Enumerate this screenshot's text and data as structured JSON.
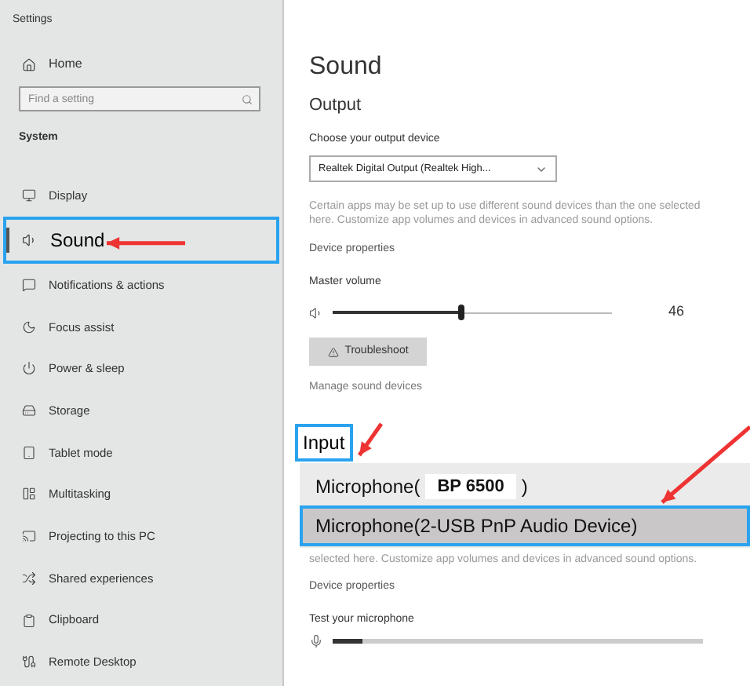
{
  "window": {
    "title": "Settings"
  },
  "sidebar": {
    "home": "Home",
    "search": {
      "placeholder": "Find a setting"
    },
    "section": "System",
    "items": [
      {
        "label": "Display",
        "selected": false
      },
      {
        "label": "Sound",
        "selected": true
      },
      {
        "label": "Notifications & actions",
        "selected": false
      },
      {
        "label": "Focus assist",
        "selected": false
      },
      {
        "label": "Power & sleep",
        "selected": false
      },
      {
        "label": "Storage",
        "selected": false
      },
      {
        "label": "Tablet mode",
        "selected": false
      },
      {
        "label": "Multitasking",
        "selected": false
      },
      {
        "label": "Projecting to this PC",
        "selected": false
      },
      {
        "label": "Shared experiences",
        "selected": false
      },
      {
        "label": "Clipboard",
        "selected": false
      },
      {
        "label": "Remote Desktop",
        "selected": false
      }
    ]
  },
  "main": {
    "title": "Sound",
    "output": {
      "heading": "Output",
      "device_label": "Choose your output device",
      "device": "Realtek Digital Output (Realtek High...",
      "note": "Certain apps may be set up to use different sound devices than the one selected here. Customize app volumes and devices in advanced sound options.",
      "properties_link": "Device properties",
      "volume_label": "Master volume",
      "volume": {
        "level": 0.46,
        "reading": "46"
      },
      "troubleshoot": "Troubleshoot",
      "manage_link": "Manage sound devices"
    },
    "input": {
      "heading": "Input",
      "devices": [
        {
          "parts": [
            {
              "kind": "plain",
              "text": "Microphone("
            },
            {
              "kind": "tag",
              "text": "BP 6500"
            },
            {
              "kind": "plain",
              "text": ")"
            }
          ],
          "selected": false
        },
        {
          "parts": [
            {
              "kind": "plain",
              "text": "Microphone(2-USB PnP Audio Device)"
            }
          ],
          "selected": true
        }
      ],
      "note": "selected here. Customize app volumes and devices in advanced sound options.",
      "properties_link": "Device properties",
      "test_label": "Test your microphone",
      "mic": {
        "level": 0.08
      }
    }
  }
}
